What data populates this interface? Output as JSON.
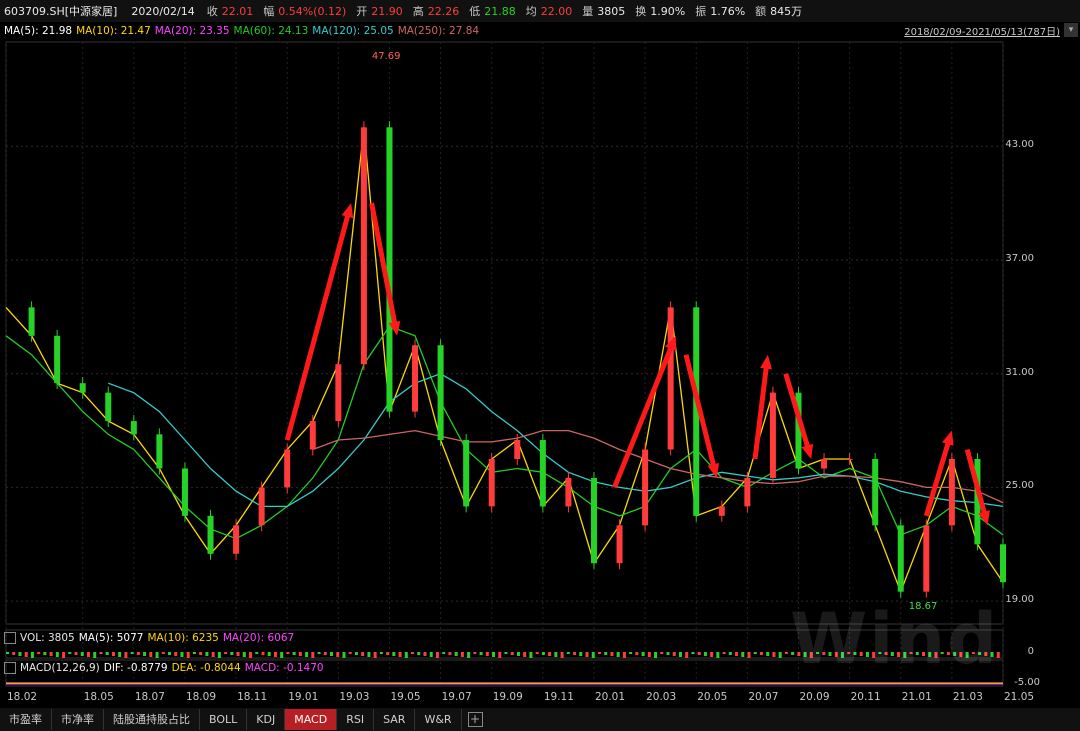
{
  "header": {
    "code": "603709.SH[中源家居]",
    "date": "2020/02/14",
    "close_label": "收",
    "close_value": "22.01",
    "change_label": "幅",
    "change_value": "0.54%(0.12)",
    "open_label": "开",
    "open_value": "21.90",
    "high_label": "高",
    "high_value": "22.26",
    "low_label": "低",
    "low_value": "21.88",
    "avg_label": "均",
    "avg_value": "22.00",
    "vol_label": "量",
    "vol_value": "3805",
    "turnover_label": "换",
    "turnover_value": "1.90%",
    "amp_label": "振",
    "amp_value": "1.76%",
    "amount_label": "额",
    "amount_value": "845万"
  },
  "ma_bar": {
    "ma5": "MA(5): 21.98",
    "ma10": "MA(10): 21.47",
    "ma20": "MA(20): 23.35",
    "ma60": "MA(60): 24.13",
    "ma120": "MA(120): 25.05",
    "ma250": "MA(250): 27.84",
    "range": "2018/02/09-2021/05/13(787日)",
    "range_btn": "▾"
  },
  "vol_bar": {
    "vol": "VOL: 3805",
    "ma5": "MA(5): 5077",
    "ma10": "MA(10): 6235",
    "ma20": "MA(20): 6067"
  },
  "macd_bar": {
    "macd": "MACD(12,26,9)",
    "dif": "DIF: -0.8779",
    "dea": "DEA: -0.8044",
    "macdv": "MACD: -0.1470"
  },
  "tabs": [
    "市盈率",
    "市净率",
    "陆股通持股占比",
    "BOLL",
    "KDJ",
    "MACD",
    "RSI",
    "SAR",
    "W&R"
  ],
  "active_tab": "MACD",
  "watermark": "Wind",
  "annotations": {
    "high": "47.69",
    "low": "18.67"
  },
  "colors": {
    "up": "#ff3b3b",
    "down": "#27d227",
    "ma5": "#ffffff",
    "ma10": "#ffd800",
    "ma20": "#ff44ff",
    "ma60": "#22cc22",
    "ma120": "#33cccc",
    "ma250": "#cc6666",
    "arrow": "#ff1a1a"
  },
  "chart_data": {
    "type": "line",
    "title": "",
    "xlabel": "",
    "ylabel": "",
    "ylim": [
      17.9,
      48.5
    ],
    "y_ticks": [
      "43.00",
      "37.00",
      "31.00",
      "25.00",
      "19.00"
    ],
    "x_ticks": [
      "18.02",
      "18.05",
      "18.07",
      "18.09",
      "18.11",
      "19.01",
      "19.03",
      "19.05",
      "19.07",
      "19.09",
      "19.11",
      "20.01",
      "20.03",
      "20.05",
      "20.07",
      "20.09",
      "20.11",
      "21.01",
      "21.03",
      "21.05"
    ],
    "x": [
      "18.02",
      "18.03",
      "18.04",
      "18.05",
      "18.06",
      "18.07",
      "18.08",
      "18.09",
      "18.10",
      "18.11",
      "18.12",
      "19.01",
      "19.02",
      "19.03",
      "19.04",
      "19.05",
      "19.06",
      "19.07",
      "19.08",
      "19.09",
      "19.10",
      "19.11",
      "19.12",
      "20.01",
      "20.02",
      "20.03",
      "20.04",
      "20.05",
      "20.06",
      "20.07",
      "20.08",
      "20.09",
      "20.10",
      "20.11",
      "20.12",
      "21.01",
      "21.02",
      "21.03",
      "21.04",
      "21.05"
    ],
    "series": [
      {
        "name": "MA(5)",
        "values": [
          34.5,
          33.0,
          30.5,
          30.0,
          28.5,
          27.8,
          26.0,
          23.5,
          21.5,
          23.0,
          25.0,
          27.0,
          28.5,
          31.5,
          44.0,
          29.0,
          32.5,
          27.5,
          24.0,
          26.5,
          27.5,
          24.0,
          25.5,
          21.0,
          23.0,
          27.0,
          34.5,
          23.5,
          24.0,
          25.5,
          30.0,
          26.0,
          26.5,
          26.5,
          23.0,
          19.5,
          23.0,
          26.5,
          22.0,
          20.0
        ]
      },
      {
        "name": "MA(60)",
        "values": [
          33.0,
          32.0,
          30.5,
          29.0,
          27.8,
          27.0,
          25.5,
          24.0,
          22.8,
          22.3,
          23.0,
          24.0,
          25.5,
          27.5,
          31.5,
          33.5,
          33.0,
          29.5,
          27.0,
          25.8,
          26.0,
          25.8,
          25.0,
          24.0,
          23.5,
          24.0,
          26.0,
          27.0,
          25.5,
          25.0,
          25.8,
          26.5,
          25.5,
          26.0,
          25.5,
          22.5,
          23.0,
          24.0,
          23.5,
          22.5
        ]
      },
      {
        "name": "MA(120)",
        "values": [
          null,
          null,
          null,
          null,
          30.5,
          30.0,
          29.0,
          27.5,
          26.0,
          24.8,
          24.0,
          24.0,
          24.8,
          26.0,
          27.5,
          29.5,
          30.5,
          31.0,
          30.2,
          29.0,
          28.0,
          26.8,
          25.8,
          25.3,
          25.0,
          24.8,
          25.0,
          25.5,
          25.8,
          25.6,
          25.4,
          25.5,
          25.7,
          25.6,
          25.3,
          24.8,
          24.5,
          24.3,
          24.2,
          24.0
        ]
      },
      {
        "name": "MA(250)",
        "values": [
          null,
          null,
          null,
          null,
          null,
          null,
          null,
          null,
          null,
          null,
          null,
          null,
          27.0,
          27.5,
          27.6,
          27.8,
          28.0,
          27.7,
          27.4,
          27.4,
          27.6,
          28.0,
          28.0,
          27.6,
          27.0,
          26.5,
          26.0,
          25.7,
          25.5,
          25.3,
          25.2,
          25.3,
          25.6,
          25.6,
          25.5,
          25.3,
          25.0,
          25.0,
          24.8,
          24.2
        ]
      }
    ],
    "annotations": [
      {
        "x": "19.04",
        "y": 47.69,
        "text": "47.69"
      },
      {
        "x": "21.01",
        "y": 18.67,
        "text": "18.67"
      }
    ],
    "grid": true,
    "legend": "top-left"
  }
}
